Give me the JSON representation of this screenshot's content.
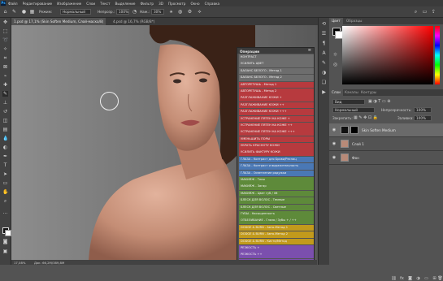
{
  "menubar": {
    "logo": "Ps",
    "items": [
      "Файл",
      "Редактирование",
      "Изображение",
      "Слои",
      "Текст",
      "Выделение",
      "Фильтр",
      "3D",
      "Просмотр",
      "Окно",
      "Справка"
    ]
  },
  "options": {
    "mode_label": "Режим:",
    "mode_value": "Нормальный",
    "opacity_label": "Непрозр.:",
    "opacity_value": "100%",
    "flow_label": "Наж.:",
    "flow_value": "30%"
  },
  "tabs": {
    "doc1": "1.psd @ 17,1% (Skin Soften Medium, Слой-маска/8)",
    "doc2": "4.psd @ 16,7% (RGB/8*)"
  },
  "status": {
    "zoom": "17,08%",
    "doc": "Док: 66,2M/389,8M"
  },
  "actions": {
    "title": "Операции",
    "menu_icon": "hamburger-icon",
    "items": [
      {
        "label": "КОНТРАСТ",
        "color": "#6d6d6d"
      },
      {
        "label": "УСИЛИТЬ ЦВЕТ",
        "color": "#6d6d6d"
      },
      {
        "label": "БАЛАНС БЕЛОГО - Метод 1",
        "color": "#6d6d6d"
      },
      {
        "label": "БАЛАНС БЕЛОГО - Метод 2",
        "color": "#6d6d6d"
      },
      {
        "label": "АВТОРЕТУШЬ - Метод 1",
        "color": "#b73a3e"
      },
      {
        "label": "АВТОРЕТУШЬ - Метод 2",
        "color": "#b73a3e"
      },
      {
        "label": "РАЗГЛАЖИВАНИЕ КОЖИ +",
        "color": "#b73a3e"
      },
      {
        "label": "РАЗГЛАЖИВАНИЕ КОЖИ ++",
        "color": "#b73a3e"
      },
      {
        "label": "РАЗГЛАЖИВАНИЕ КОЖИ +++",
        "color": "#b73a3e"
      },
      {
        "label": "УСТРАНЕНИЕ ПЯТЕН НА КОЖЕ +",
        "color": "#b73a3e"
      },
      {
        "label": "УСТРАНЕНИЕ ПЯТЕН НА КОЖЕ ++",
        "color": "#b73a3e"
      },
      {
        "label": "УСТРАНЕНИЕ ПЯТЕН НА КОЖЕ +++",
        "color": "#b73a3e"
      },
      {
        "label": "УМЕНЬШИТЬ ПОРЫ",
        "color": "#b73a3e"
      },
      {
        "label": "УБРАТЬ КРАСНОТУ КОЖИ",
        "color": "#b73a3e"
      },
      {
        "label": "УСИЛИТЬ ФАКТУРУ КОЖИ",
        "color": "#b73a3e"
      },
      {
        "label": "ГЛАЗА - Контраст для Брови/Ресниц",
        "color": "#4a78b5"
      },
      {
        "label": "ГЛАЗА - Контраст и выразительность",
        "color": "#4a78b5"
      },
      {
        "label": "ГЛАЗА - Осветление радужки",
        "color": "#4a78b5"
      },
      {
        "label": "МАКИЯЖ - Тени",
        "color": "#5e8a3a"
      },
      {
        "label": "МАКИЯЖ - Загар",
        "color": "#5e8a3a"
      },
      {
        "label": "МАКИЯЖ - Цвет губ / lift",
        "color": "#5e8a3a"
      },
      {
        "label": "БЛЕСК ДЛЯ ВОЛОС - Темные",
        "color": "#5e8a3a"
      },
      {
        "label": "БЛЕСК ДЛЯ ВОЛОС - Светлые",
        "color": "#5e8a3a"
      },
      {
        "label": "ГУБЫ - Насыщенность",
        "color": "#5e8a3a"
      },
      {
        "label": "ОТБЕЛИВАНИЕ - Глаза / Зубы + / ++",
        "color": "#5e8a3a"
      },
      {
        "label": "DODGE & BURN - Авто-Метод 1",
        "color": "#c29a1c"
      },
      {
        "label": "DODGE & BURN - Авто-Метод 2",
        "color": "#c29a1c"
      },
      {
        "label": "DODGE & BURN - Кисти/Метод",
        "color": "#c29a1c"
      },
      {
        "label": "РЕЗКОСТЬ +",
        "color": "#7b4fae"
      },
      {
        "label": "РЕЗКОСТЬ ++",
        "color": "#7b4fae"
      },
      {
        "label": "РЕЗКОСТЬ +++",
        "color": "#7b4fae"
      },
      {
        "label": "РЕЗКОСТЬ - Фрукты",
        "color": "#7b4fae"
      }
    ]
  },
  "panels": {
    "color_tab": "Цвет",
    "swatches_tab": "Образцы",
    "layers_tab": "Слои",
    "channels_tab": "Каналы",
    "paths_tab": "Контуры",
    "kind_label": "Вид",
    "blend_mode": "Нормальный",
    "opacity_label": "Непрозрачность:",
    "opacity_value": "100%",
    "lock_label": "Закрепить:",
    "fill_label": "Заливка:",
    "fill_value": "100%",
    "layers": [
      {
        "name": "Skin Soften Medium",
        "selected": true,
        "thumb": "#111111",
        "mask": true
      },
      {
        "name": "Слой 1",
        "selected": false,
        "thumb": "#b88a78",
        "mask": false
      },
      {
        "name": "Фон",
        "selected": false,
        "thumb": "#b88a78",
        "mask": false
      }
    ]
  }
}
